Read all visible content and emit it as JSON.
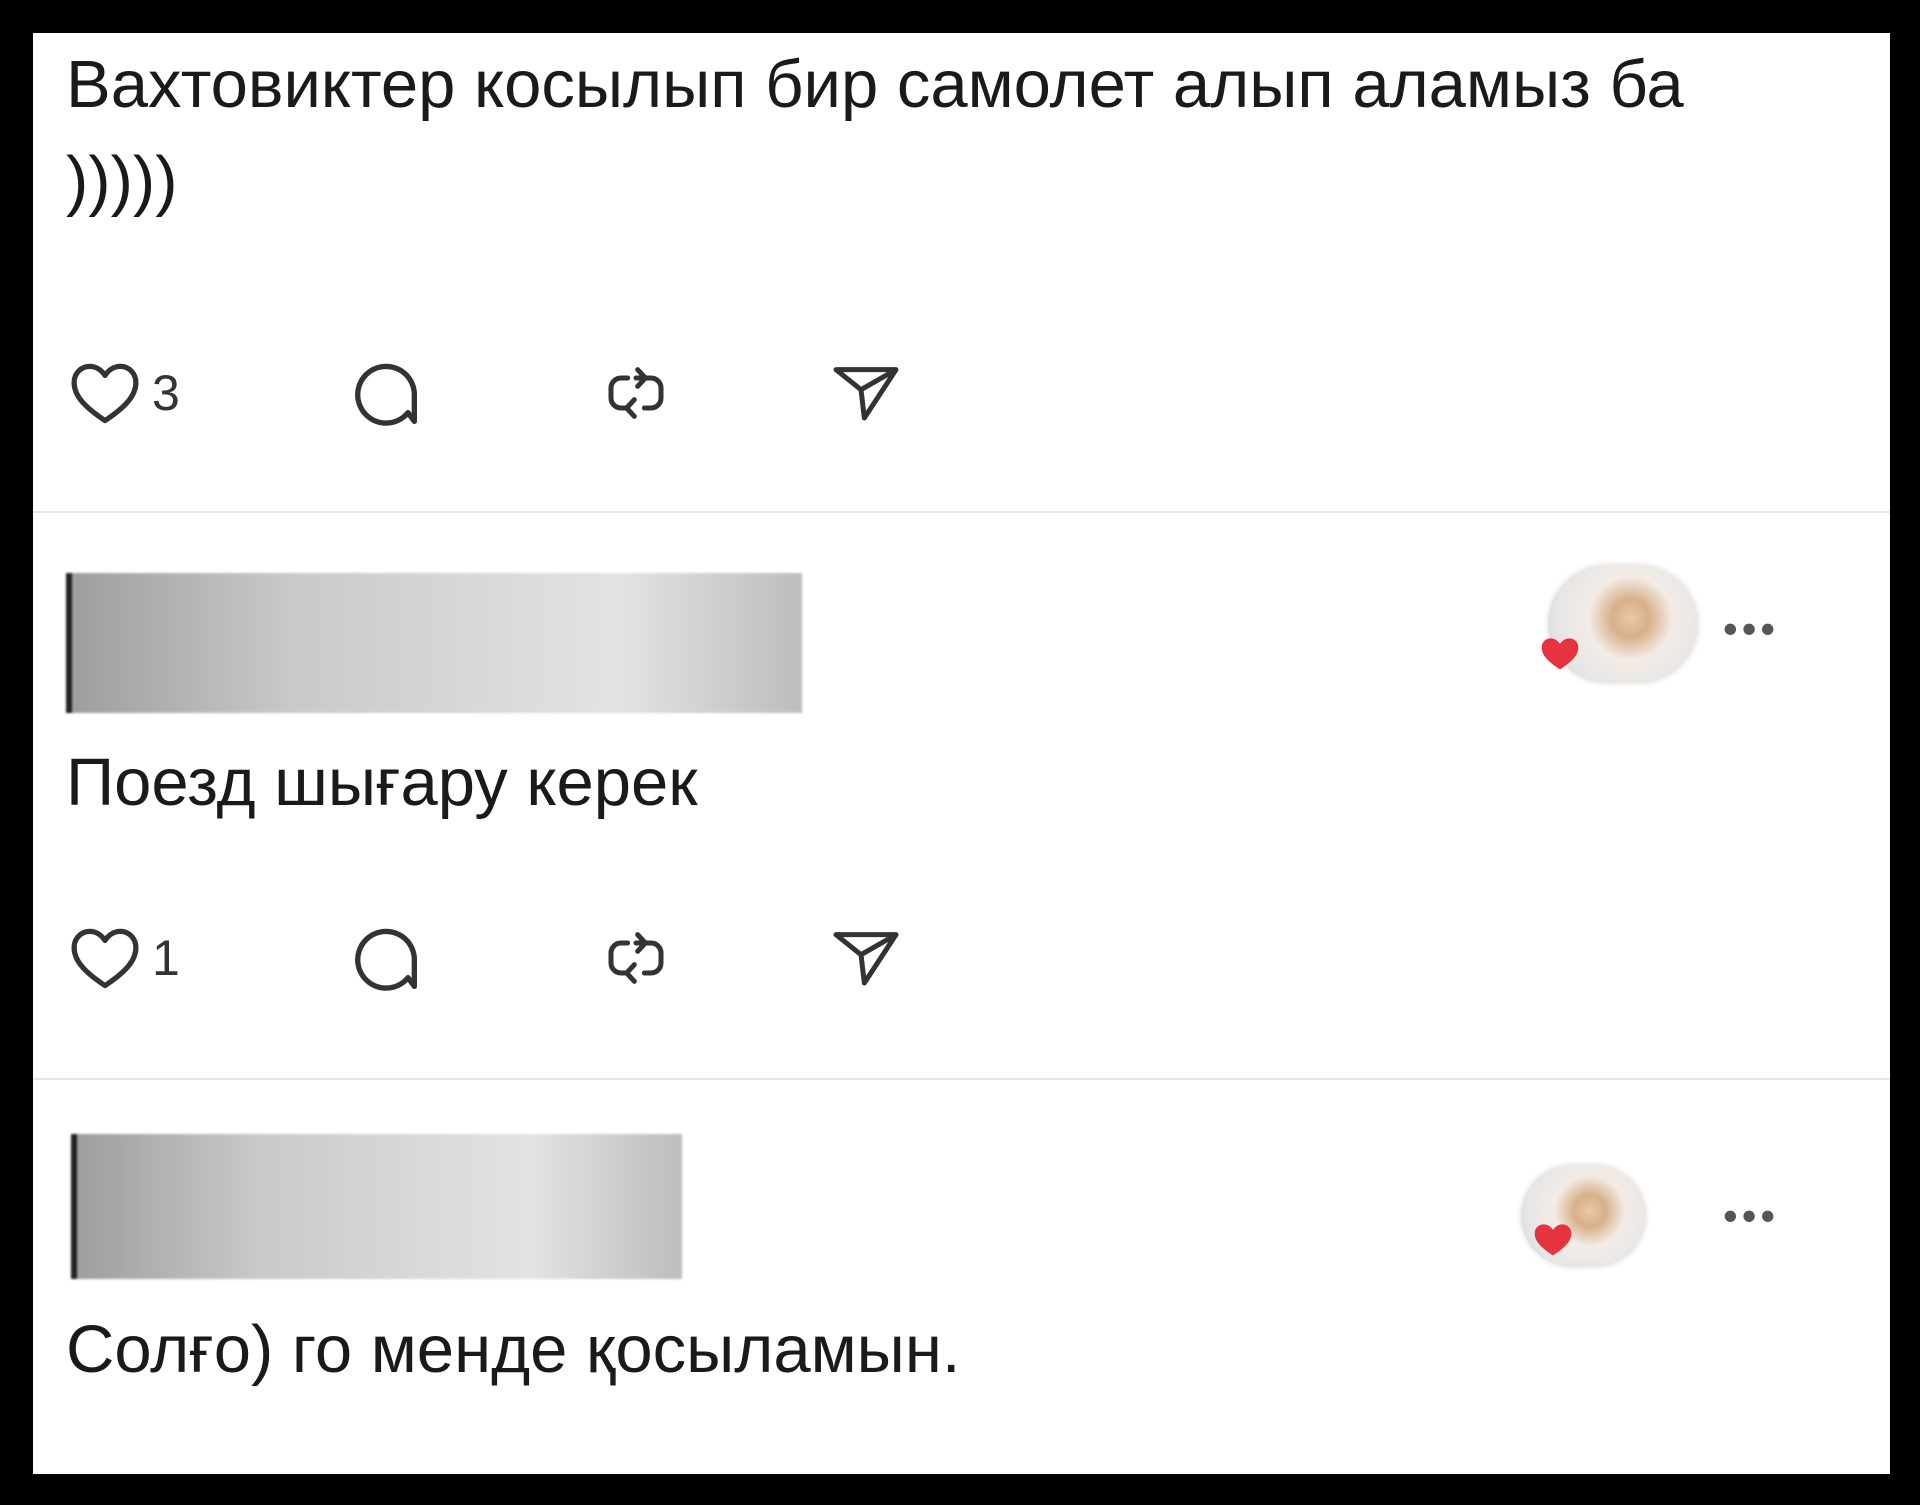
{
  "posts": [
    {
      "author": "",
      "text": "Вахтовиктер косылып бир самолет алып аламыз ба )))))",
      "likes": "3",
      "icons": [
        "heart-icon",
        "comment-icon",
        "repost-icon",
        "share-icon"
      ]
    },
    {
      "author": "",
      "text": "Поезд шығару керек",
      "likes": "1",
      "icons": [
        "heart-icon",
        "comment-icon",
        "repost-icon",
        "share-icon",
        "more-icon"
      ]
    },
    {
      "author": "",
      "text": "Солғо) го менде қосыламын.",
      "icons": [
        "more-icon"
      ]
    }
  ],
  "more_label": "•••",
  "colors": {
    "background": "#ffffff",
    "text": "#1a1a1a",
    "icon": "#333333",
    "divider": "#e6e6e6",
    "heart_badge": "#e5333f"
  }
}
